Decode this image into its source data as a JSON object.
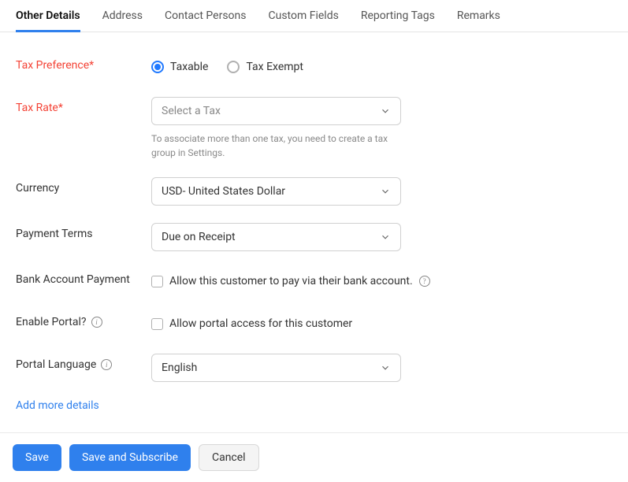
{
  "tabs": [
    {
      "label": "Other Details",
      "active": true
    },
    {
      "label": "Address",
      "active": false
    },
    {
      "label": "Contact Persons",
      "active": false
    },
    {
      "label": "Custom Fields",
      "active": false
    },
    {
      "label": "Reporting Tags",
      "active": false
    },
    {
      "label": "Remarks",
      "active": false
    }
  ],
  "fields": {
    "tax_preference": {
      "label": "Tax Preference*",
      "options": {
        "taxable": "Taxable",
        "exempt": "Tax Exempt"
      }
    },
    "tax_rate": {
      "label": "Tax Rate*",
      "placeholder": "Select a Tax",
      "hint": "To associate more than one tax, you need to create a tax group in Settings."
    },
    "currency": {
      "label": "Currency",
      "value": "USD- United States Dollar"
    },
    "payment_terms": {
      "label": "Payment Terms",
      "value": "Due on Receipt"
    },
    "bank_account": {
      "label": "Bank Account Payment",
      "checkbox_label": "Allow this customer to pay via their bank account."
    },
    "enable_portal": {
      "label": "Enable Portal?",
      "checkbox_label": "Allow portal access for this customer"
    },
    "portal_language": {
      "label": "Portal Language",
      "value": "English"
    }
  },
  "links": {
    "add_more": "Add more details"
  },
  "footer": {
    "save": "Save",
    "save_subscribe": "Save and Subscribe",
    "cancel": "Cancel"
  }
}
